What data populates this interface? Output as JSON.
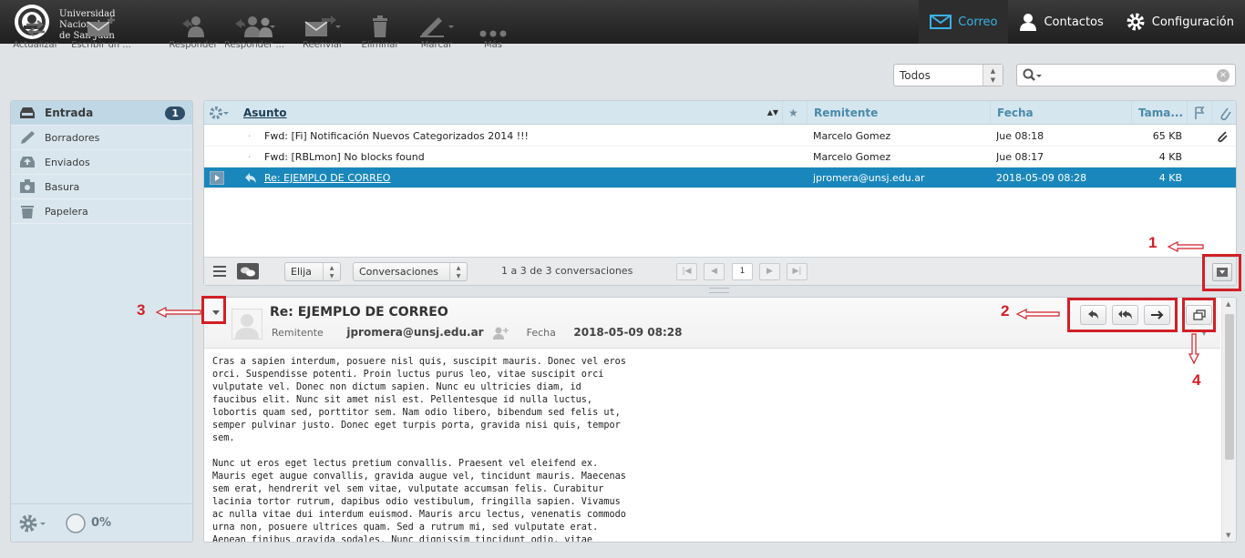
{
  "university": {
    "line1": "Universidad",
    "line2": "Nacional",
    "line3": "de San Juan"
  },
  "topnav": [
    {
      "label": "Correo",
      "active": true
    },
    {
      "label": "Contactos",
      "active": false
    },
    {
      "label": "Configuración",
      "active": false
    }
  ],
  "toolbar": {
    "actualizar": "Actualizar",
    "escribir": "Escribir un ...",
    "responder": "Responder",
    "responder_todos": "Responder ...",
    "reenviar": "Reenviar",
    "eliminar": "Eliminar",
    "marcar": "Marcar",
    "mas": "Más"
  },
  "filter": {
    "selected": "Todos"
  },
  "folders": [
    {
      "label": "Entrada",
      "count": "1",
      "icon": "inbox-icon"
    },
    {
      "label": "Borradores",
      "icon": "pencil-icon"
    },
    {
      "label": "Enviados",
      "icon": "sent-icon"
    },
    {
      "label": "Basura",
      "icon": "junk-icon"
    },
    {
      "label": "Papelera",
      "icon": "trash-icon"
    }
  ],
  "quota": "0%",
  "list": {
    "headers": {
      "subject": "Asunto",
      "from": "Remitente",
      "date": "Fecha",
      "size": "Tama..."
    },
    "rows": [
      {
        "subject": "Fwd: [Fi] Notificación Nuevos Categorizados 2014 !!!",
        "from": "Marcelo Gomez",
        "date": "Jue 08:18",
        "size": "65 KB",
        "attachment": true
      },
      {
        "subject": "Fwd: [RBLmon] No blocks found",
        "from": "Marcelo Gomez",
        "date": "Jue 08:17",
        "size": "4 KB",
        "attachment": false
      },
      {
        "subject": "Re: EJEMPLO DE CORREO",
        "from": "jpromera@unsj.edu.ar",
        "date": "2018-05-09 08:28",
        "size": "4 KB",
        "attachment": false
      }
    ],
    "select_label": "Elija",
    "mode_label": "Conversaciones",
    "count_text": "1 a 3 de 3 conversaciones",
    "page": "1"
  },
  "message": {
    "subject": "Re: EJEMPLO DE CORREO",
    "from_label": "Remitente",
    "from": "jpromera@unsj.edu.ar",
    "date_label": "Fecha",
    "date": "2018-05-09 08:28",
    "body": "Cras a sapien interdum, posuere nisl quis, suscipit mauris. Donec vel eros\norci. Suspendisse potenti. Proin luctus purus leo, vitae suscipit orci\nvulputate vel. Donec non dictum sapien. Nunc eu ultricies diam, id\nfaucibus elit. Nunc sit amet nisl est. Pellentesque id nulla luctus,\nlobortis quam sed, porttitor sem. Nam odio libero, bibendum sed felis ut,\nsemper pulvinar justo. Donec eget turpis porta, gravida nisi quis, tempor\nsem.\n\nNunc ut eros eget lectus pretium convallis. Praesent vel eleifend ex.\nMauris eget augue convallis, gravida augue vel, tincidunt mauris. Maecenas\nsem erat, hendrerit vel sem vitae, vulputate accumsan felis. Curabitur\nlacinia tortor rutrum, dapibus odio vestibulum, fringilla sapien. Vivamus\nac nulla vitae dui interdum euismod. Mauris arcu lectus, venenatis commodo\nurna non, posuere ultrices quam. Sed a rutrum mi, sed vulputate erat.\nAenean finibus gravida sodales. Nunc dignissim tincidunt odio, vitae"
  },
  "annotations": [
    "1",
    "2",
    "3",
    "4"
  ],
  "colors": {
    "accent": "#1a87bc",
    "annotation": "#d21f26",
    "topbar": "#2b2b2b"
  }
}
